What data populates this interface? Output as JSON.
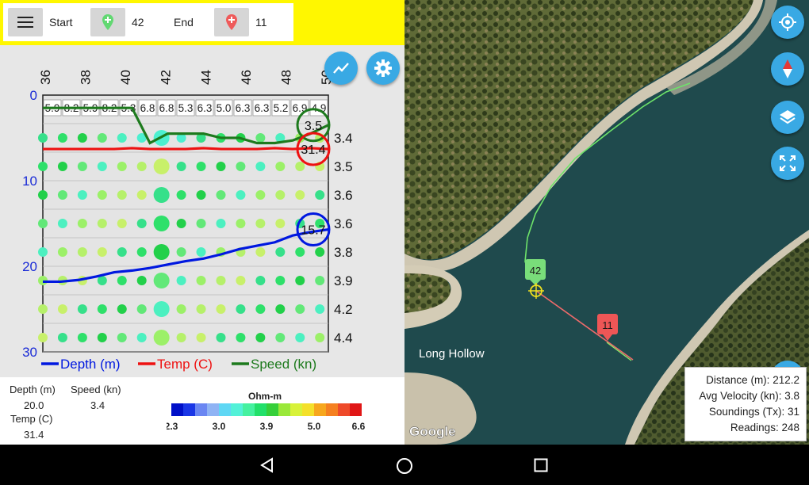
{
  "toolbar": {
    "start_label": "Start",
    "start_value": "42",
    "end_label": "End",
    "end_value": "11"
  },
  "chart_data": {
    "type": "line",
    "x_ticks": [
      "36",
      "38",
      "40",
      "42",
      "44",
      "46",
      "48",
      "50"
    ],
    "y_ticks": [
      "0",
      "10",
      "20",
      "30"
    ],
    "ylim": [
      0,
      30
    ],
    "right_labels": [
      "3.4",
      "3.5",
      "3.6",
      "3.6",
      "3.8",
      "3.9",
      "4.2",
      "4.4"
    ],
    "speed_values_top": [
      "5.9",
      "8.2",
      "5.9",
      "8.2",
      "5.3",
      "6.8",
      "6.8",
      "5.3",
      "6.3",
      "5.0",
      "6.3",
      "6.3",
      "5.2",
      "6.9",
      "4.9"
    ],
    "series": [
      {
        "name": "Depth (m)",
        "color": "#0018e0",
        "values": [
          21.8,
          21.8,
          21.6,
          21.2,
          20.7,
          20.5,
          20.2,
          19.8,
          19.4,
          19.1,
          18.6,
          18.0,
          17.6,
          17.2,
          16.4,
          16.0,
          15.7
        ]
      },
      {
        "name": "Temp (C)",
        "color": "#ee1111",
        "values": [
          6.3,
          6.3,
          6.3,
          6.3,
          6.3,
          6.2,
          6.3,
          6.3,
          6.3,
          6.2,
          6.3,
          6.3,
          6.3,
          6.2,
          6.3,
          6.2,
          6.3
        ]
      },
      {
        "name": "Speed (kn)",
        "color": "#1d7a1d",
        "values": [
          1.5,
          1.5,
          1.5,
          1.5,
          1.5,
          1.5,
          5.6,
          4.5,
          4.5,
          4.5,
          5.0,
          5.0,
          5.6,
          5.6,
          5.3,
          4.5,
          3.5
        ]
      }
    ],
    "current": {
      "speed": "3.5",
      "temp": "31.4",
      "depth": "15.7"
    },
    "legend_position": "bottom"
  },
  "info": {
    "depth_label": "Depth (m)",
    "depth_value": "20.0",
    "speed_label": "Speed (kn)",
    "speed_value": "3.4",
    "temp_label": "Temp (C)",
    "temp_value": "31.4"
  },
  "colorbar": {
    "title": "Ohm-m",
    "tick_labels": [
      "2.3",
      "3.0",
      "3.9",
      "5.0",
      "6.6"
    ],
    "colors": [
      "#0010c8",
      "#1a36e6",
      "#6a86f2",
      "#8fb3f4",
      "#5fd7f4",
      "#53f1d8",
      "#45f1a0",
      "#22e06a",
      "#36cf3a",
      "#9ae83a",
      "#d8f23a",
      "#f4e02a",
      "#f7a71d",
      "#f58020",
      "#ee4a2a",
      "#e01616"
    ]
  },
  "map": {
    "place_label": "Long Hollow",
    "google_label": "Google",
    "marker_start": "42",
    "marker_end": "11",
    "stats": {
      "distance_label": "Distance (m):",
      "distance_value": "212.2",
      "velocity_label": "Avg Velocity (kn):",
      "velocity_value": "3.8",
      "soundings_label": "Soundings (Tx):",
      "soundings_value": "31",
      "readings_label": "Readings:",
      "readings_value": "248"
    }
  },
  "icons": [
    "menu-icon",
    "start-pin-icon",
    "end-pin-icon",
    "chart-icon",
    "gear-icon",
    "my-location-icon",
    "compass-icon",
    "layers-icon",
    "fullscreen-icon",
    "back-icon",
    "home-icon",
    "recents-icon"
  ]
}
